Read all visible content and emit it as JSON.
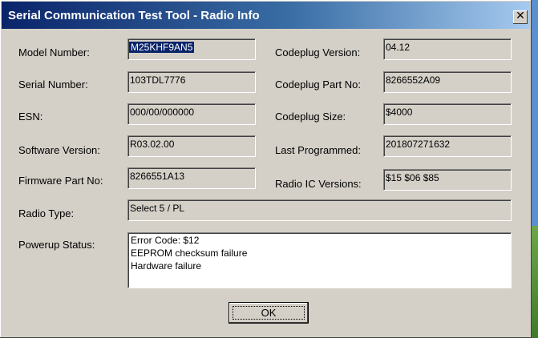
{
  "window": {
    "title": "Serial Communication Test Tool  -  Radio Info",
    "close_icon": "close-icon"
  },
  "left": {
    "model_number": {
      "label": "Model Number:",
      "value": "M25KHF9AN5"
    },
    "serial_number": {
      "label": "Serial Number:",
      "value": "103TDL7776"
    },
    "esn": {
      "label": "ESN:",
      "value": "000/00/000000"
    },
    "software_version": {
      "label": "Software Version:",
      "value": "R03.02.00"
    },
    "firmware_part_no": {
      "label": "Firmware Part No:",
      "value": "8266551A13"
    }
  },
  "right": {
    "codeplug_version": {
      "label": "Codeplug Version:",
      "value": "04.12"
    },
    "codeplug_part_no": {
      "label": "Codeplug Part No:",
      "value": "8266552A09"
    },
    "codeplug_size": {
      "label": "Codeplug Size:",
      "value": "$4000"
    },
    "last_programmed": {
      "label": "Last Programmed:",
      "value": "201807271632"
    },
    "radio_ic_versions": {
      "label": "Radio IC Versions:",
      "value": "$15 $06 $85"
    }
  },
  "radio_type": {
    "label": "Radio Type:",
    "value": "Select 5 / PL"
  },
  "powerup_status": {
    "label": "Powerup Status:",
    "lines": [
      "Error Code: $12",
      "EEPROM checksum failure",
      "Hardware failure"
    ]
  },
  "ok_button": {
    "label": "OK"
  },
  "colors": {
    "title_start": "#0a246a",
    "title_end": "#a6caf0",
    "dialog_bg": "#d4d0c8"
  }
}
